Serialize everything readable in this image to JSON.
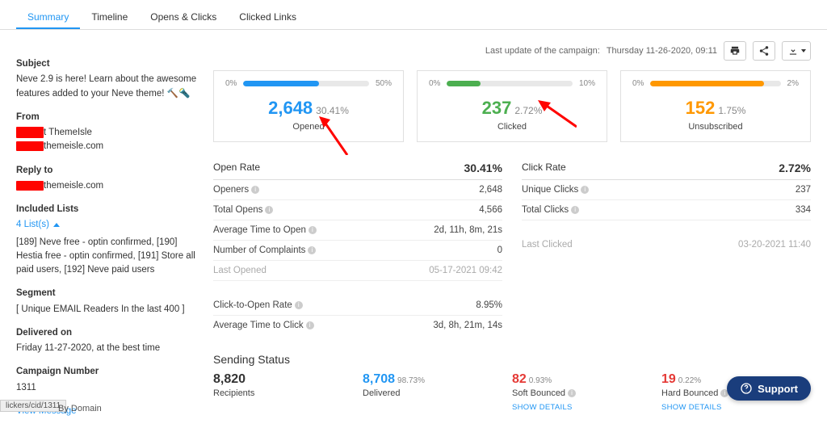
{
  "tabs": {
    "summary": "Summary",
    "timeline": "Timeline",
    "opens_clicks": "Opens & Clicks",
    "clicked_links": "Clicked Links"
  },
  "toprow": {
    "label": "Last update of the campaign:",
    "date": "Thursday 11-26-2020, 09:11"
  },
  "sidebar": {
    "subject_label": "Subject",
    "subject_value": "Neve 2.9 is here! Learn about the awesome features added to your Neve theme! 🔨🔦",
    "from_label": "From",
    "from_name_suffix": "t ThemeIsle",
    "from_email_suffix": "themeisle.com",
    "reply_label": "Reply to",
    "reply_suffix": "themeisle.com",
    "lists_label": "Included Lists",
    "lists_link": "4 List(s)",
    "lists_detail": "[189] Neve free - optin confirmed, [190] Hestia free - optin confirmed, [191] Store all paid users, [192] Neve paid users",
    "segment_label": "Segment",
    "segment_value": "[ Unique EMAIL Readers In the last 400 ]",
    "delivered_label": "Delivered on",
    "delivered_value": "Friday 11-27-2020, at the best time",
    "campnum_label": "Campaign Number",
    "campnum_value": "1311",
    "view_message": "View Message"
  },
  "cards": {
    "c1": {
      "lo": "0%",
      "hi": "50%",
      "value": "2,648",
      "pct": "30.41%",
      "label": "Opened",
      "fill": 60
    },
    "c2": {
      "lo": "0%",
      "hi": "10%",
      "value": "237",
      "pct": "2.72%",
      "label": "Clicked",
      "fill": 27
    },
    "c3": {
      "lo": "0%",
      "hi": "2%",
      "value": "152",
      "pct": "1.75%",
      "label": "Unsubscribed",
      "fill": 87
    }
  },
  "open_rate": {
    "title": "Open Rate",
    "value": "30.41%",
    "rows": [
      {
        "k": "Openers",
        "v": "2,648"
      },
      {
        "k": "Total Opens",
        "v": "4,566"
      },
      {
        "k": "Average Time to Open",
        "v": "2d, 11h, 8m, 21s"
      },
      {
        "k": "Number of Complaints",
        "v": "0"
      },
      {
        "k": "Last Opened",
        "v": "05-17-2021 09:42",
        "muted": true
      },
      {
        "k": "Click-to-Open Rate",
        "v": "8.95%",
        "gap": true
      },
      {
        "k": "Average Time to Click",
        "v": "3d, 8h, 21m, 14s"
      }
    ]
  },
  "click_rate": {
    "title": "Click Rate",
    "value": "2.72%",
    "rows": [
      {
        "k": "Unique Clicks",
        "v": "237"
      },
      {
        "k": "Total Clicks",
        "v": "334"
      },
      {
        "k": "Last Clicked",
        "v": "03-20-2021 11:40",
        "muted": true,
        "gap": true
      }
    ]
  },
  "sending": {
    "title": "Sending Status",
    "recipients_n": "8,820",
    "recipients_l": "Recipients",
    "delivered_n": "8,708",
    "delivered_pct": "98.73%",
    "delivered_l": "Delivered",
    "soft_n": "82",
    "soft_pct": "0.93%",
    "soft_l": "Soft Bounced",
    "hard_n": "19",
    "hard_pct": "0.22%",
    "hard_l": "Hard Bounced",
    "show_details": "SHOW DETAILS"
  },
  "support": "Support",
  "statusbar": "lickers/cid/1311",
  "by_domain": "By Domain"
}
